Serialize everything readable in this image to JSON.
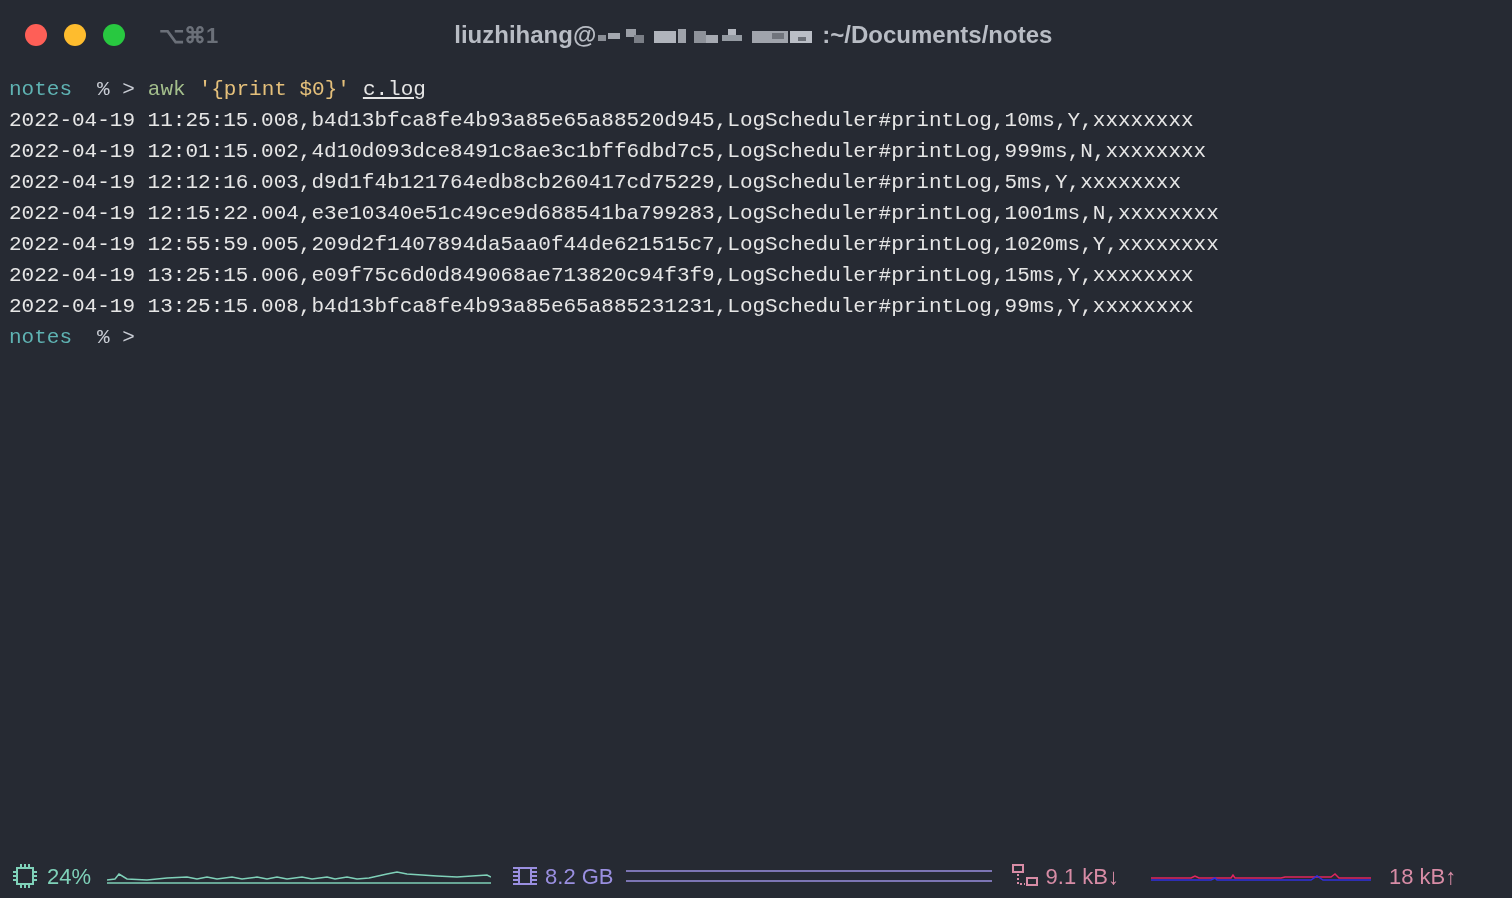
{
  "window": {
    "shortcut": "⌥⌘1",
    "title_user": "liuzhihang@",
    "title_path": ":~/Documents/notes"
  },
  "terminal": [
    {
      "kind": "prompt",
      "dir": "notes",
      "symbol": "% >",
      "command": "awk",
      "argument": "'{print $0}'",
      "file": "c.log"
    },
    {
      "kind": "output",
      "text": "2022-04-19 11:25:15.008,b4d13bfca8fe4b93a85e65a88520d945,LogScheduler#printLog,10ms,Y,xxxxxxxx"
    },
    {
      "kind": "output",
      "text": "2022-04-19 12:01:15.002,4d10d093dce8491c8ae3c1bff6dbd7c5,LogScheduler#printLog,999ms,N,xxxxxxxx"
    },
    {
      "kind": "output",
      "text": "2022-04-19 12:12:16.003,d9d1f4b121764edb8cb260417cd75229,LogScheduler#printLog,5ms,Y,xxxxxxxx"
    },
    {
      "kind": "output",
      "text": "2022-04-19 12:15:22.004,e3e10340e51c49ce9d688541ba799283,LogScheduler#printLog,1001ms,N,xxxxxxxx"
    },
    {
      "kind": "output",
      "text": "2022-04-19 12:55:59.005,209d2f1407894da5aa0f44de621515c7,LogScheduler#printLog,1020ms,Y,xxxxxxxx"
    },
    {
      "kind": "output",
      "text": "2022-04-19 13:25:15.006,e09f75c6d0d849068ae713820c94f3f9,LogScheduler#printLog,15ms,Y,xxxxxxxx"
    },
    {
      "kind": "output",
      "text": "2022-04-19 13:25:15.008,b4d13bfca8fe4b93a85e65a885231231,LogScheduler#printLog,99ms,Y,xxxxxxxx"
    },
    {
      "kind": "prompt",
      "dir": "notes",
      "symbol": "% >"
    }
  ],
  "status_bar": {
    "cpu": "24%",
    "memory": "8.2 GB",
    "download": "9.1 kB↓",
    "upload": "18 kB↑"
  }
}
